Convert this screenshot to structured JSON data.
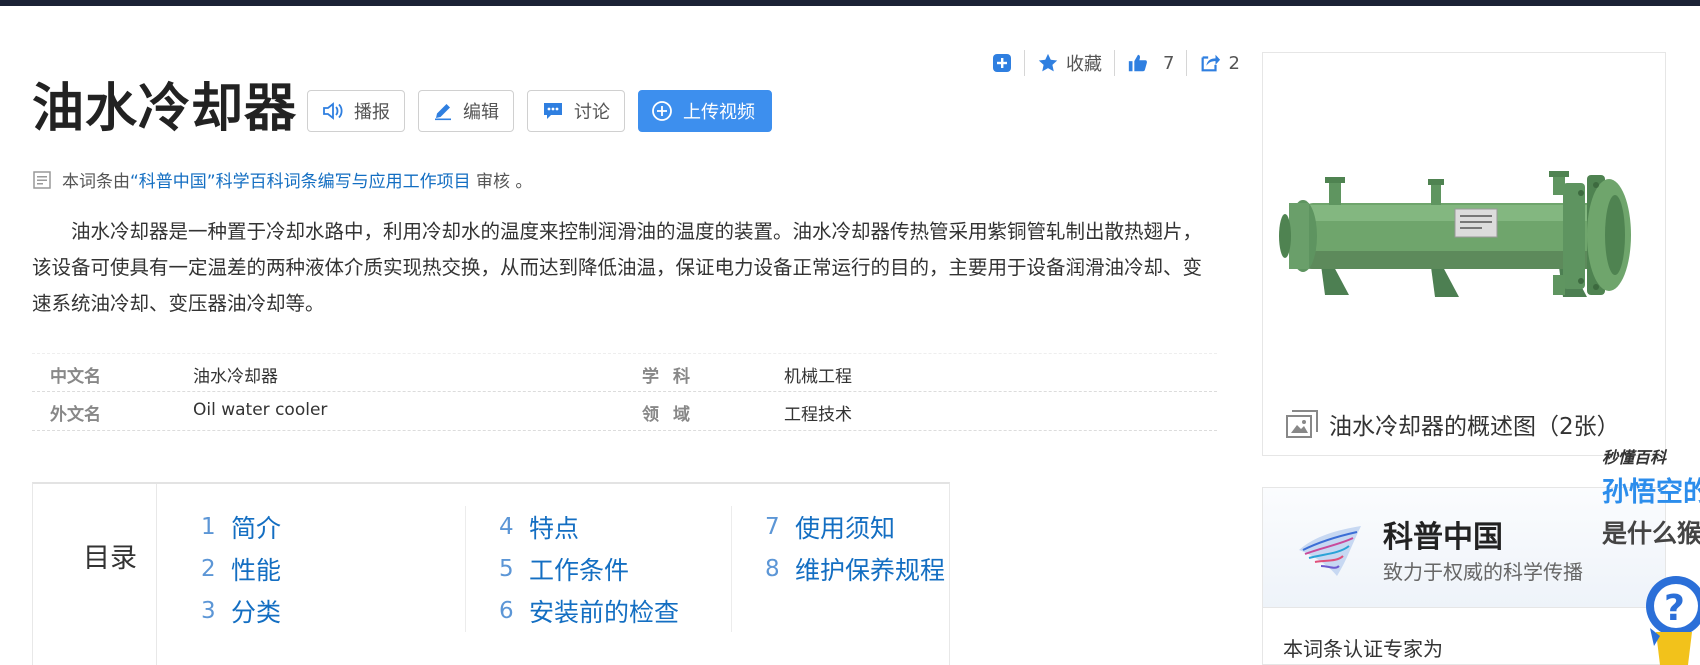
{
  "actions": {
    "favorite_label": "收藏",
    "like_count": "7",
    "share_count": "2"
  },
  "title": "油水冷却器",
  "buttons": {
    "broadcast": "播报",
    "edit": "编辑",
    "discuss": "讨论",
    "upload_video": "上传视频"
  },
  "review": {
    "prefix": "本词条由",
    "link": "“科普中国”科学百科词条编写与应用工作项目",
    "suffix": " 审核 。"
  },
  "summary": "油水冷却器是一种置于冷却水路中，利用冷却水的温度来控制润滑油的温度的装置。油水冷却器传热管采用紫铜管轧制出散热翅片，该设备可使具有一定温差的两种液体介质实现热交换，从而达到降低油温，保证电力设备正常运行的目的，主要用于设备润滑油冷却、变速系统油冷却、变压器油冷却等。",
  "basic_info": [
    {
      "k1": "中文名",
      "v1": "油水冷却器",
      "k2": "学科",
      "v2": "机械工程"
    },
    {
      "k1": "外文名",
      "v1": "Oil water cooler",
      "k2": "领域",
      "v2": "工程技术"
    }
  ],
  "catalog": {
    "heading": "目录",
    "items": [
      {
        "num": "1",
        "label": "简介"
      },
      {
        "num": "2",
        "label": "性能"
      },
      {
        "num": "3",
        "label": "分类"
      },
      {
        "num": "4",
        "label": "特点"
      },
      {
        "num": "5",
        "label": "工作条件"
      },
      {
        "num": "6",
        "label": "安装前的检查"
      },
      {
        "num": "7",
        "label": "使用须知"
      },
      {
        "num": "8",
        "label": "维护保养规程"
      }
    ]
  },
  "summary_pic": {
    "caption": "油水冷却器的概述图（2张）"
  },
  "kepu": {
    "name": "科普中国",
    "slogan": "致力于权威的科学传播",
    "expert_label": "本词条认证专家为"
  },
  "ad": {
    "brand": "秒懂百科",
    "line1": "孙悟空的",
    "line2": "是什么猴"
  },
  "colors": {
    "link": "#136ec2",
    "primary_button": "#3d8fee",
    "topbar": "#1b2235"
  }
}
